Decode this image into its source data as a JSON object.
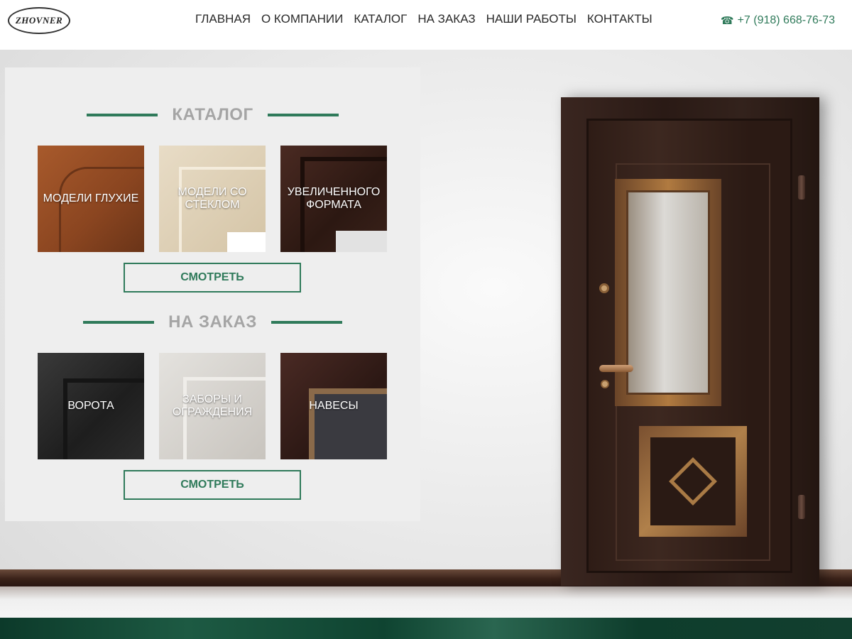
{
  "header": {
    "logo_text": "ZHOVNER",
    "nav": [
      {
        "label": "ГЛАВНАЯ"
      },
      {
        "label": "О КОМПАНИИ"
      },
      {
        "label": "КАТАЛОГ"
      },
      {
        "label": "НА ЗАКАЗ"
      },
      {
        "label": "НАШИ РАБОТЫ"
      },
      {
        "label": "КОНТАКТЫ"
      }
    ],
    "phone": "+7 (918) 668-76-73",
    "phone_icon": "phone-icon"
  },
  "catalog": {
    "title": "КАТАЛОГ",
    "tiles": [
      {
        "label": "МОДЕЛИ ГЛУХИЕ"
      },
      {
        "label": "МОДЕЛИ СО СТЕКЛОМ"
      },
      {
        "label": "УВЕЛИЧЕННОГО ФОРМАТА"
      }
    ],
    "button_label": "СМОТРЕТЬ"
  },
  "custom": {
    "title": "НА ЗАКАЗ",
    "tiles": [
      {
        "label": "ВОРОТА"
      },
      {
        "label": "ЗАБОРЫ И ОГРАЖДЕНИЯ"
      },
      {
        "label": "НАВЕСЫ"
      }
    ],
    "button_label": "СМОТРЕТЬ"
  },
  "colors": {
    "accent": "#2f7a5a",
    "heading_gray": "#a5a5a5",
    "panel_bg": "#eeeeee"
  }
}
